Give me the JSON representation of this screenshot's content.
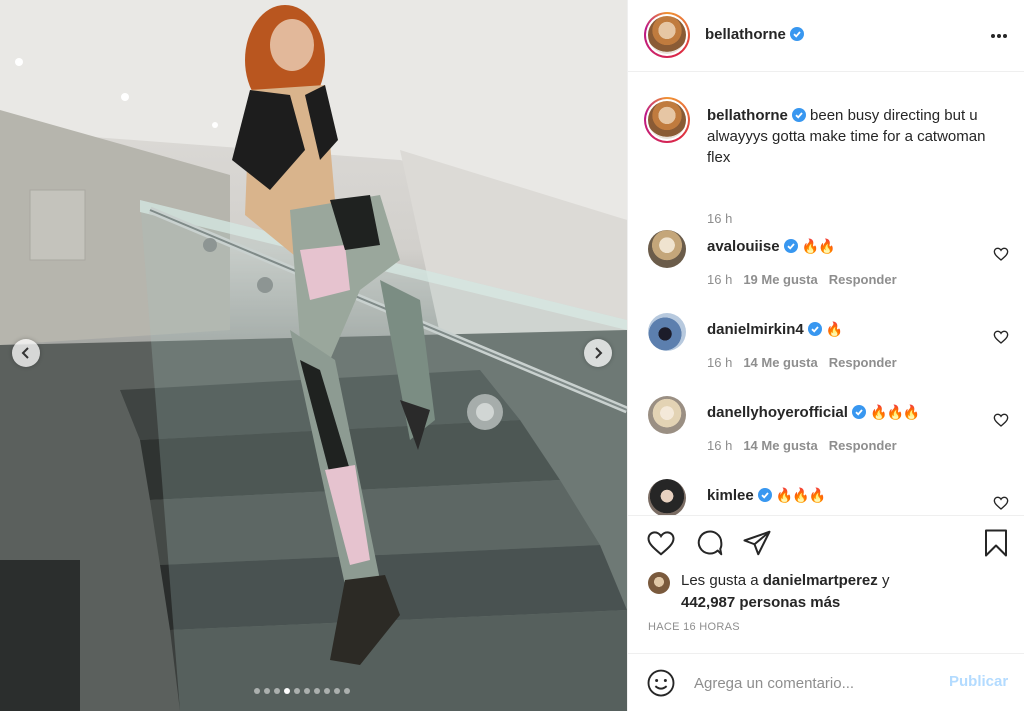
{
  "post": {
    "author": "bellathorne",
    "verified": true,
    "more_icon": "more-horizontal-icon"
  },
  "caption": {
    "username": "bellathorne",
    "text": "been busy directing but u alwayyys gotta make time for a catwoman flex",
    "time": "16 h"
  },
  "comments": [
    {
      "username": "avalouiise",
      "text": "🔥🔥",
      "time": "16 h",
      "likes": "19 Me gusta",
      "reply": "Responder"
    },
    {
      "username": "danielmirkin4",
      "text": "🔥",
      "time": "16 h",
      "likes": "14 Me gusta",
      "reply": "Responder"
    },
    {
      "username": "danellyhoyerofficial",
      "text": "🔥🔥🔥",
      "time": "16 h",
      "likes": "14 Me gusta",
      "reply": "Responder"
    },
    {
      "username": "kimlee",
      "text": "🔥🔥🔥",
      "time": "",
      "likes": "",
      "reply": ""
    }
  ],
  "likes": {
    "prefix": "Les gusta a",
    "user": "danielmartperez",
    "connector": "y",
    "count": "442,987 personas más"
  },
  "timestamp": "HACE 16 HORAS",
  "comment_box": {
    "placeholder": "Agrega un comentario...",
    "publish": "Publicar"
  },
  "carousel": {
    "total": 10,
    "active_index": 3
  },
  "colors": {
    "verified": "#3897f0",
    "publish": "#b3dbff",
    "muted": "#8e8e8e"
  }
}
